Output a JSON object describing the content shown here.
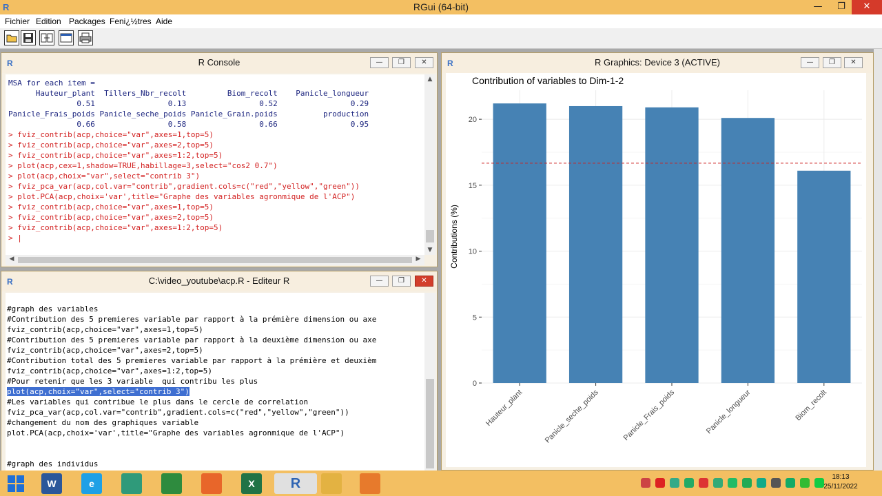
{
  "app": {
    "title": "RGui (64-bit)",
    "logo": "R",
    "controls": {
      "minimize": "—",
      "maximize": "❐",
      "close": "✕"
    }
  },
  "menu": [
    "Fichier",
    "Edition",
    "Packages",
    "Feni¿½tres",
    "Aide"
  ],
  "toolbar": {
    "buttons": [
      "open-script-icon",
      "save-icon",
      "load-workspace-icon",
      "window-icon",
      "print-icon"
    ]
  },
  "console": {
    "title": "R Console",
    "lines": [
      {
        "t": "out",
        "s": "MSA for each item ="
      },
      {
        "t": "out",
        "s": "      Hauteur_plant  Tillers_Nbr_recolt         Biom_recolt    Panicle_longueur"
      },
      {
        "t": "out",
        "s": "               0.51                0.13                0.52                0.29"
      },
      {
        "t": "out",
        "s": "Panicle_Frais_poids Panicle_seche_poids Panicle_Grain.poids          production"
      },
      {
        "t": "out",
        "s": "               0.66                0.58                0.66                0.95"
      },
      {
        "t": "cmd",
        "s": "> fviz_contrib(acp,choice=\"var\",axes=1,top=5)"
      },
      {
        "t": "cmd",
        "s": "> fviz_contrib(acp,choice=\"var\",axes=2,top=5)"
      },
      {
        "t": "cmd",
        "s": "> fviz_contrib(acp,choice=\"var\",axes=1:2,top=5)"
      },
      {
        "t": "cmd",
        "s": "> plot(acp,cex=1,shadow=TRUE,habillage=3,select=\"cos2 0.7\")"
      },
      {
        "t": "cmd",
        "s": "> plot(acp,choix=\"var\",select=\"contrib 3\")"
      },
      {
        "t": "cmd",
        "s": "> fviz_pca_var(acp,col.var=\"contrib\",gradient.cols=c(\"red\",\"yellow\",\"green\"))"
      },
      {
        "t": "cmd",
        "s": "> plot.PCA(acp,choix='var',title=\"Graphe des variables agronmique de l'ACP\")"
      },
      {
        "t": "cmd",
        "s": "> fviz_contrib(acp,choice=\"var\",axes=1,top=5)"
      },
      {
        "t": "cmd",
        "s": "> fviz_contrib(acp,choice=\"var\",axes=2,top=5)"
      },
      {
        "t": "cmd",
        "s": "> fviz_contrib(acp,choice=\"var\",axes=1:2,top=5)"
      },
      {
        "t": "cmd",
        "s": "> |"
      }
    ]
  },
  "editor": {
    "title": "C:\\video_youtube\\acp.R - Editeur R",
    "lines": [
      {
        "t": "ed",
        "s": ""
      },
      {
        "t": "ed",
        "s": "#graph des variables"
      },
      {
        "t": "ed",
        "s": "#Contribution des 5 premieres variable par rapport à la prémière dimension ou axe"
      },
      {
        "t": "ed",
        "s": "fviz_contrib(acp,choice=\"var\",axes=1,top=5)"
      },
      {
        "t": "ed",
        "s": "#Contribution des 5 premieres variable par rapport à la deuxième dimension ou axe"
      },
      {
        "t": "ed",
        "s": "fviz_contrib(acp,choice=\"var\",axes=2,top=5)"
      },
      {
        "t": "ed",
        "s": "#Contribution total des 5 premieres variable par rapport à la prémière et deuxièm"
      },
      {
        "t": "ed",
        "s": "fviz_contrib(acp,choice=\"var\",axes=1:2,top=5)"
      },
      {
        "t": "ed",
        "s": "#Pour retenir que les 3 variable  qui contribu les plus"
      },
      {
        "t": "sel",
        "s": "plot(acp,choix=\"var\",select=\"contrib 3\")"
      },
      {
        "t": "ed",
        "s": "#Les variables qui contribue le plus dans le cercle de correlation"
      },
      {
        "t": "ed",
        "s": "fviz_pca_var(acp,col.var=\"contrib\",gradient.cols=c(\"red\",\"yellow\",\"green\"))"
      },
      {
        "t": "ed",
        "s": "#changement du nom des graphiques variable"
      },
      {
        "t": "ed",
        "s": "plot.PCA(acp,choix='var',title=\"Graphe des variables agronmique de l'ACP\")"
      },
      {
        "t": "ed",
        "s": ""
      },
      {
        "t": "ed",
        "s": ""
      },
      {
        "t": "ed",
        "s": "#graph des individus"
      }
    ]
  },
  "graphics": {
    "title": "R Graphics: Device 3 (ACTIVE)"
  },
  "chart_data": {
    "type": "bar",
    "title": "Contribution of variables to Dim-1-2",
    "xlabel": "",
    "ylabel": "Contributions (%)",
    "categories": [
      "Hauteur_plant",
      "Panicle_seche_poids",
      "Panicle_Frais_poids",
      "Panicle_longueur",
      "Biom_recolt"
    ],
    "values": [
      21.2,
      21.0,
      20.9,
      20.1,
      16.1
    ],
    "reference_line": 16.67,
    "ylim": [
      0,
      22.2
    ],
    "yticks": [
      0,
      5,
      10,
      15,
      20
    ],
    "bar_color": "#4682b4",
    "reference_color": "#cc2222",
    "grid": true
  },
  "taskbar": {
    "apps": [
      {
        "name": "windows-start-icon",
        "label": "",
        "color": "#1f6fd6"
      },
      {
        "name": "word-icon",
        "label": "W",
        "color": "#2b579a"
      },
      {
        "name": "internet-explorer-icon",
        "label": "e",
        "color": "#1ea0e6"
      },
      {
        "name": "edge-icon",
        "label": "",
        "color": "#2f9a7a"
      },
      {
        "name": "store-icon",
        "label": "",
        "color": "#2e8b3e"
      },
      {
        "name": "firefox-icon",
        "label": "",
        "color": "#e8662a"
      },
      {
        "name": "excel-icon",
        "label": "X",
        "color": "#217346"
      },
      {
        "name": "r-icon",
        "label": "R",
        "color": "#2f64b3"
      },
      {
        "name": "file-explorer-icon",
        "label": "",
        "color": "#e3b242"
      },
      {
        "name": "media-player-icon",
        "label": "",
        "color": "#e77a2c"
      }
    ],
    "clock": {
      "time": "18:13",
      "date": "25/11/2022"
    }
  }
}
